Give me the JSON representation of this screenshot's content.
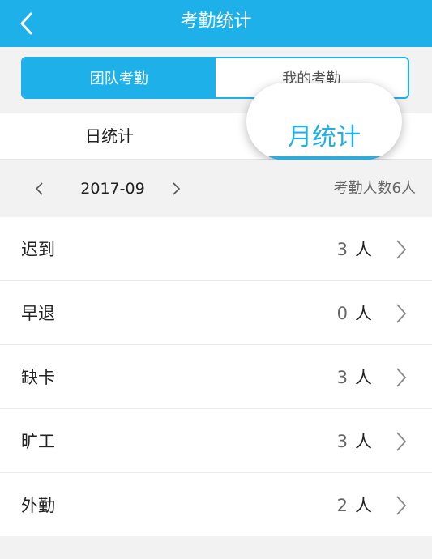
{
  "header": {
    "title": "考勤统计",
    "back_icon": "chevron-left-icon"
  },
  "segmented": {
    "team_label": "团队考勤",
    "mine_label": "我的考勤",
    "active": "team"
  },
  "tabs": {
    "day_label": "日统计",
    "month_label": "月统计",
    "active": "month"
  },
  "period": {
    "date": "2017-09",
    "headcount": "考勤人数6人"
  },
  "stats": [
    {
      "label": "迟到",
      "count": "3",
      "unit": "人"
    },
    {
      "label": "早退",
      "count": "0",
      "unit": "人"
    },
    {
      "label": "缺卡",
      "count": "3",
      "unit": "人"
    },
    {
      "label": "旷工",
      "count": "3",
      "unit": "人"
    },
    {
      "label": "外勤",
      "count": "2",
      "unit": "人"
    }
  ],
  "colors": {
    "brand": "#1eb0e8",
    "background": "#f2f2f2",
    "text": "#222222",
    "muted": "#666666"
  }
}
